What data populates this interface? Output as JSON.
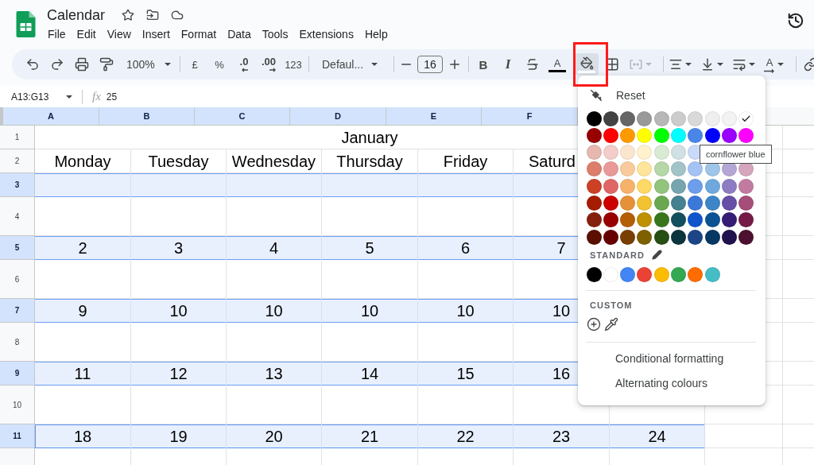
{
  "document": {
    "title": "Calendar",
    "menu": [
      "File",
      "Edit",
      "View",
      "Insert",
      "Format",
      "Data",
      "Tools",
      "Extensions",
      "Help"
    ]
  },
  "toolbar": {
    "zoom": "100%",
    "currency": "£",
    "percent": "%",
    "decrease_decimals": ".0",
    "increase_decimals": ".00",
    "number_format": "123",
    "font": "Defaul...",
    "font_size": "16",
    "bold": "B",
    "italic": "I",
    "text_color": "A",
    "fill_color": {
      "open": true
    },
    "merge_cells": {
      "disabled": true
    },
    "text_rotation": "A"
  },
  "formula_bar": {
    "range": "A13:G13",
    "function_label": "fx",
    "value": "25"
  },
  "sheet": {
    "columns": [
      {
        "label": "A",
        "selected": true
      },
      {
        "label": "B",
        "selected": true
      },
      {
        "label": "C",
        "selected": true
      },
      {
        "label": "D",
        "selected": true
      },
      {
        "label": "E",
        "selected": true
      },
      {
        "label": "F",
        "selected": true
      }
    ],
    "rows": [
      {
        "number": "1",
        "kind": "title",
        "selected": false,
        "active": false,
        "cells": [
          "January"
        ]
      },
      {
        "number": "2",
        "kind": "weekdays",
        "selected": false,
        "active": false,
        "cells": [
          "Monday",
          "Tuesday",
          "Wednesday",
          "Thursday",
          "Friday",
          "Saturd"
        ]
      },
      {
        "number": "3",
        "kind": "dates",
        "selected": true,
        "active": false
      },
      {
        "number": "4",
        "kind": "notes",
        "selected": false,
        "active": false
      },
      {
        "number": "5",
        "kind": "dates",
        "selected": true,
        "active": false,
        "cells": [
          "2",
          "3",
          "4",
          "5",
          "6",
          "7"
        ]
      },
      {
        "number": "6",
        "kind": "notes",
        "selected": false,
        "active": false
      },
      {
        "number": "7",
        "kind": "dates",
        "selected": true,
        "active": false,
        "cells": [
          "9",
          "10",
          "10",
          "10",
          "10",
          "10"
        ]
      },
      {
        "number": "8",
        "kind": "notes",
        "selected": false,
        "active": false
      },
      {
        "number": "9",
        "kind": "dates",
        "selected": true,
        "active": false,
        "cells": [
          "11",
          "12",
          "13",
          "14",
          "15",
          "16"
        ]
      },
      {
        "number": "10",
        "kind": "notes",
        "selected": false,
        "active": false
      },
      {
        "number": "11",
        "kind": "dates",
        "selected": true,
        "active": true,
        "cells": [
          "18",
          "19",
          "20",
          "21",
          "22",
          "23",
          "24"
        ]
      }
    ]
  },
  "fill_menu": {
    "reset": "Reset",
    "palette": [
      [
        {
          "color": "#000000",
          "selected": false
        },
        {
          "color": "#434343",
          "selected": false
        },
        {
          "color": "#666666",
          "selected": false
        },
        {
          "color": "#999999",
          "selected": false
        },
        {
          "color": "#b7b7b7",
          "selected": false
        },
        {
          "color": "#cccccc",
          "selected": false
        },
        {
          "color": "#d9d9d9",
          "selected": false
        },
        {
          "color": "#efefef",
          "selected": false
        },
        {
          "color": "#f3f3f3",
          "selected": false
        },
        {
          "color": "#ffffff",
          "selected": true
        }
      ],
      [
        {
          "color": "#980000",
          "selected": false
        },
        {
          "color": "#ff0000",
          "selected": false
        },
        {
          "color": "#ff9900",
          "selected": false
        },
        {
          "color": "#ffff00",
          "selected": false
        },
        {
          "color": "#00ff00",
          "selected": false
        },
        {
          "color": "#00ffff",
          "selected": false
        },
        {
          "color": "#4a86e8",
          "selected": false
        },
        {
          "color": "#0000ff",
          "selected": false
        },
        {
          "color": "#9900ff",
          "selected": false
        },
        {
          "color": "#ff00ff",
          "selected": false
        }
      ],
      [
        {
          "color": "#e6b8af",
          "selected": false
        },
        {
          "color": "#f4cccc",
          "selected": false
        },
        {
          "color": "#fce5cd",
          "selected": false
        },
        {
          "color": "#fff2cc",
          "selected": false
        },
        {
          "color": "#d9ead3",
          "selected": false
        },
        {
          "color": "#d0e0e3",
          "selected": false
        },
        {
          "color": "#c9daf8",
          "selected": false
        }
      ],
      [
        {
          "color": "#dd7e6b",
          "selected": false
        },
        {
          "color": "#ea9999",
          "selected": false
        },
        {
          "color": "#f9cb9c",
          "selected": false
        },
        {
          "color": "#ffe599",
          "selected": false
        },
        {
          "color": "#b6d7a8",
          "selected": false
        },
        {
          "color": "#a2c4c9",
          "selected": false
        },
        {
          "color": "#a4c2f4",
          "selected": false
        },
        {
          "color": "#9fc5e8",
          "selected": false
        },
        {
          "color": "#b4a7d6",
          "selected": false
        },
        {
          "color": "#d5a6bd",
          "selected": false
        }
      ],
      [
        {
          "color": "#cc4125",
          "selected": false
        },
        {
          "color": "#e06666",
          "selected": false
        },
        {
          "color": "#f6b26b",
          "selected": false
        },
        {
          "color": "#ffd966",
          "selected": false
        },
        {
          "color": "#93c47d",
          "selected": false
        },
        {
          "color": "#76a5af",
          "selected": false
        },
        {
          "color": "#6d9eeb",
          "selected": false
        },
        {
          "color": "#6fa8dc",
          "selected": false
        },
        {
          "color": "#8e7cc3",
          "selected": false
        },
        {
          "color": "#c27ba0",
          "selected": false
        }
      ],
      [
        {
          "color": "#a61c00",
          "selected": false
        },
        {
          "color": "#cc0000",
          "selected": false
        },
        {
          "color": "#e69138",
          "selected": false
        },
        {
          "color": "#f1c232",
          "selected": false
        },
        {
          "color": "#6aa84f",
          "selected": false
        },
        {
          "color": "#45818e",
          "selected": false
        },
        {
          "color": "#3c78d8",
          "selected": false
        },
        {
          "color": "#3d85c6",
          "selected": false
        },
        {
          "color": "#674ea7",
          "selected": false
        },
        {
          "color": "#a64d79",
          "selected": false
        }
      ],
      [
        {
          "color": "#85200c",
          "selected": false
        },
        {
          "color": "#990000",
          "selected": false
        },
        {
          "color": "#b45f06",
          "selected": false
        },
        {
          "color": "#bf9000",
          "selected": false
        },
        {
          "color": "#38761d",
          "selected": false
        },
        {
          "color": "#134f5c",
          "selected": false
        },
        {
          "color": "#1155cc",
          "selected": false
        },
        {
          "color": "#0b5394",
          "selected": false
        },
        {
          "color": "#351c75",
          "selected": false
        },
        {
          "color": "#741b47",
          "selected": false
        }
      ],
      [
        {
          "color": "#5b0f00",
          "selected": false
        },
        {
          "color": "#660000",
          "selected": false
        },
        {
          "color": "#783f04",
          "selected": false
        },
        {
          "color": "#7f6000",
          "selected": false
        },
        {
          "color": "#274e13",
          "selected": false
        },
        {
          "color": "#0c343d",
          "selected": false
        },
        {
          "color": "#1c4587",
          "selected": false
        },
        {
          "color": "#073763",
          "selected": false
        },
        {
          "color": "#20124d",
          "selected": false
        },
        {
          "color": "#4c1130",
          "selected": false
        }
      ]
    ],
    "standard_label": "STANDARD",
    "standard": [
      {
        "color": "#000000",
        "selected": false
      },
      {
        "color": "#ffffff",
        "selected": false
      },
      {
        "color": "#4285f4",
        "selected": false
      },
      {
        "color": "#ea4335",
        "selected": false
      },
      {
        "color": "#fbbc04",
        "selected": false
      },
      {
        "color": "#34a853",
        "selected": false
      },
      {
        "color": "#ff6d01",
        "selected": false
      },
      {
        "color": "#46bdc6",
        "selected": false
      }
    ],
    "custom_label": "CUSTOM",
    "actions": [
      "Conditional formatting",
      "Alternating colours"
    ],
    "tooltip": "cornflower blue"
  }
}
